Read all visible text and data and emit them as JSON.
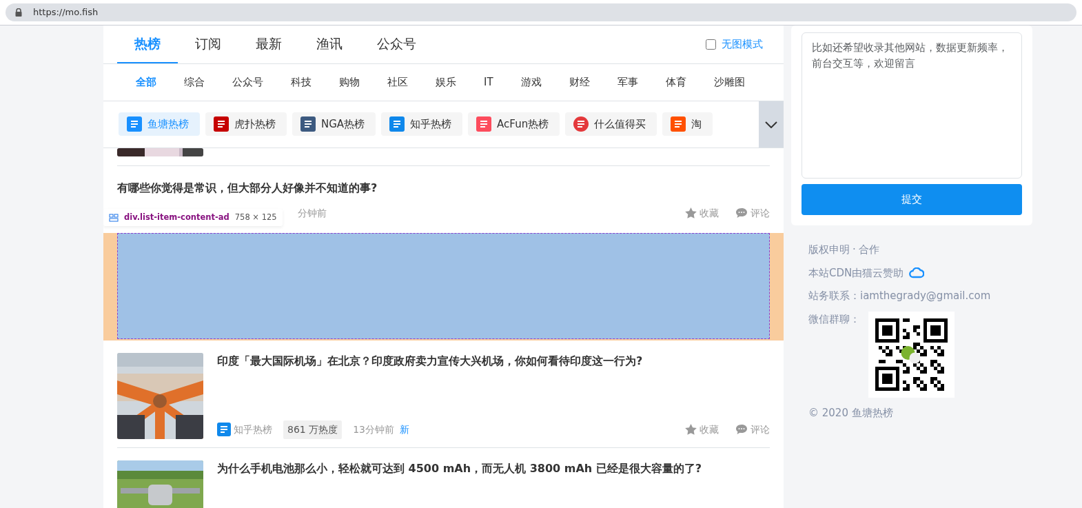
{
  "address_bar": {
    "url": "https://mo.fish"
  },
  "main_tabs": [
    {
      "label": "热榜",
      "selected": true
    },
    {
      "label": "订阅",
      "selected": false
    },
    {
      "label": "最新",
      "selected": false
    },
    {
      "label": "渔讯",
      "selected": false
    },
    {
      "label": "公众号",
      "selected": false
    }
  ],
  "no_image_mode": {
    "label": "无图模式",
    "checked": false
  },
  "categories": [
    {
      "label": "全部",
      "selected": true
    },
    {
      "label": "综合",
      "selected": false
    },
    {
      "label": "公众号",
      "selected": false
    },
    {
      "label": "科技",
      "selected": false
    },
    {
      "label": "购物",
      "selected": false
    },
    {
      "label": "社区",
      "selected": false
    },
    {
      "label": "娱乐",
      "selected": false
    },
    {
      "label": "IT",
      "selected": false
    },
    {
      "label": "游戏",
      "selected": false
    },
    {
      "label": "财经",
      "selected": false
    },
    {
      "label": "军事",
      "selected": false
    },
    {
      "label": "体育",
      "selected": false
    },
    {
      "label": "沙雕图",
      "selected": false
    }
  ],
  "sources": [
    {
      "label": "鱼塘热榜",
      "color": "#1890ff",
      "selected": true
    },
    {
      "label": "虎扑热榜",
      "color": "#c60100",
      "selected": false
    },
    {
      "label": "NGA热榜",
      "color": "#3d5a80",
      "selected": false
    },
    {
      "label": "知乎热榜",
      "color": "#0f88eb",
      "selected": false
    },
    {
      "label": "AcFun热榜",
      "color": "#fd4c5d",
      "selected": false
    },
    {
      "label": "什么值得买",
      "color": "#e4393c",
      "selected": false
    },
    {
      "label": "淘",
      "color": "#ff5000",
      "selected": false
    }
  ],
  "items": [
    {
      "kind": "covered"
    },
    {
      "kind": "text",
      "title": "有哪些你觉得是常识，但大部分人好像并不知道的事?",
      "time": "分钟前",
      "favorite": "收藏",
      "comment": "评论"
    },
    {
      "kind": "ad"
    },
    {
      "kind": "picture",
      "title": "印度「最大国际机场」在北京？印度政府卖力宣传大兴机场，你如何看待印度这一行为?",
      "source": "知乎热榜",
      "heat": "861 万热度",
      "time": "13分钟前",
      "new": "新",
      "favorite": "收藏",
      "comment": "评论"
    },
    {
      "kind": "picture-top",
      "title": "为什么手机电池那么小，轻松就可达到 4500 mAh，而无人机 3800 mAh 已经是很大容量的了?"
    }
  ],
  "inspector_tooltip": {
    "selector": "div.list-item-content-ad",
    "size": "758 × 125"
  },
  "feedback": {
    "placeholder": "比如还希望收录其他网站，数据更新频率，前台交互等，欢迎留言",
    "submit": "提交"
  },
  "footer": {
    "links": [
      "版权申明",
      "合作"
    ],
    "separator": "·",
    "cdn": "本站CDN由猫云赞助",
    "contact": "站务联系：iamthegrady@gmail.com",
    "wechat": "微信群聊：",
    "copyright": "© 2020 鱼塘热榜"
  }
}
